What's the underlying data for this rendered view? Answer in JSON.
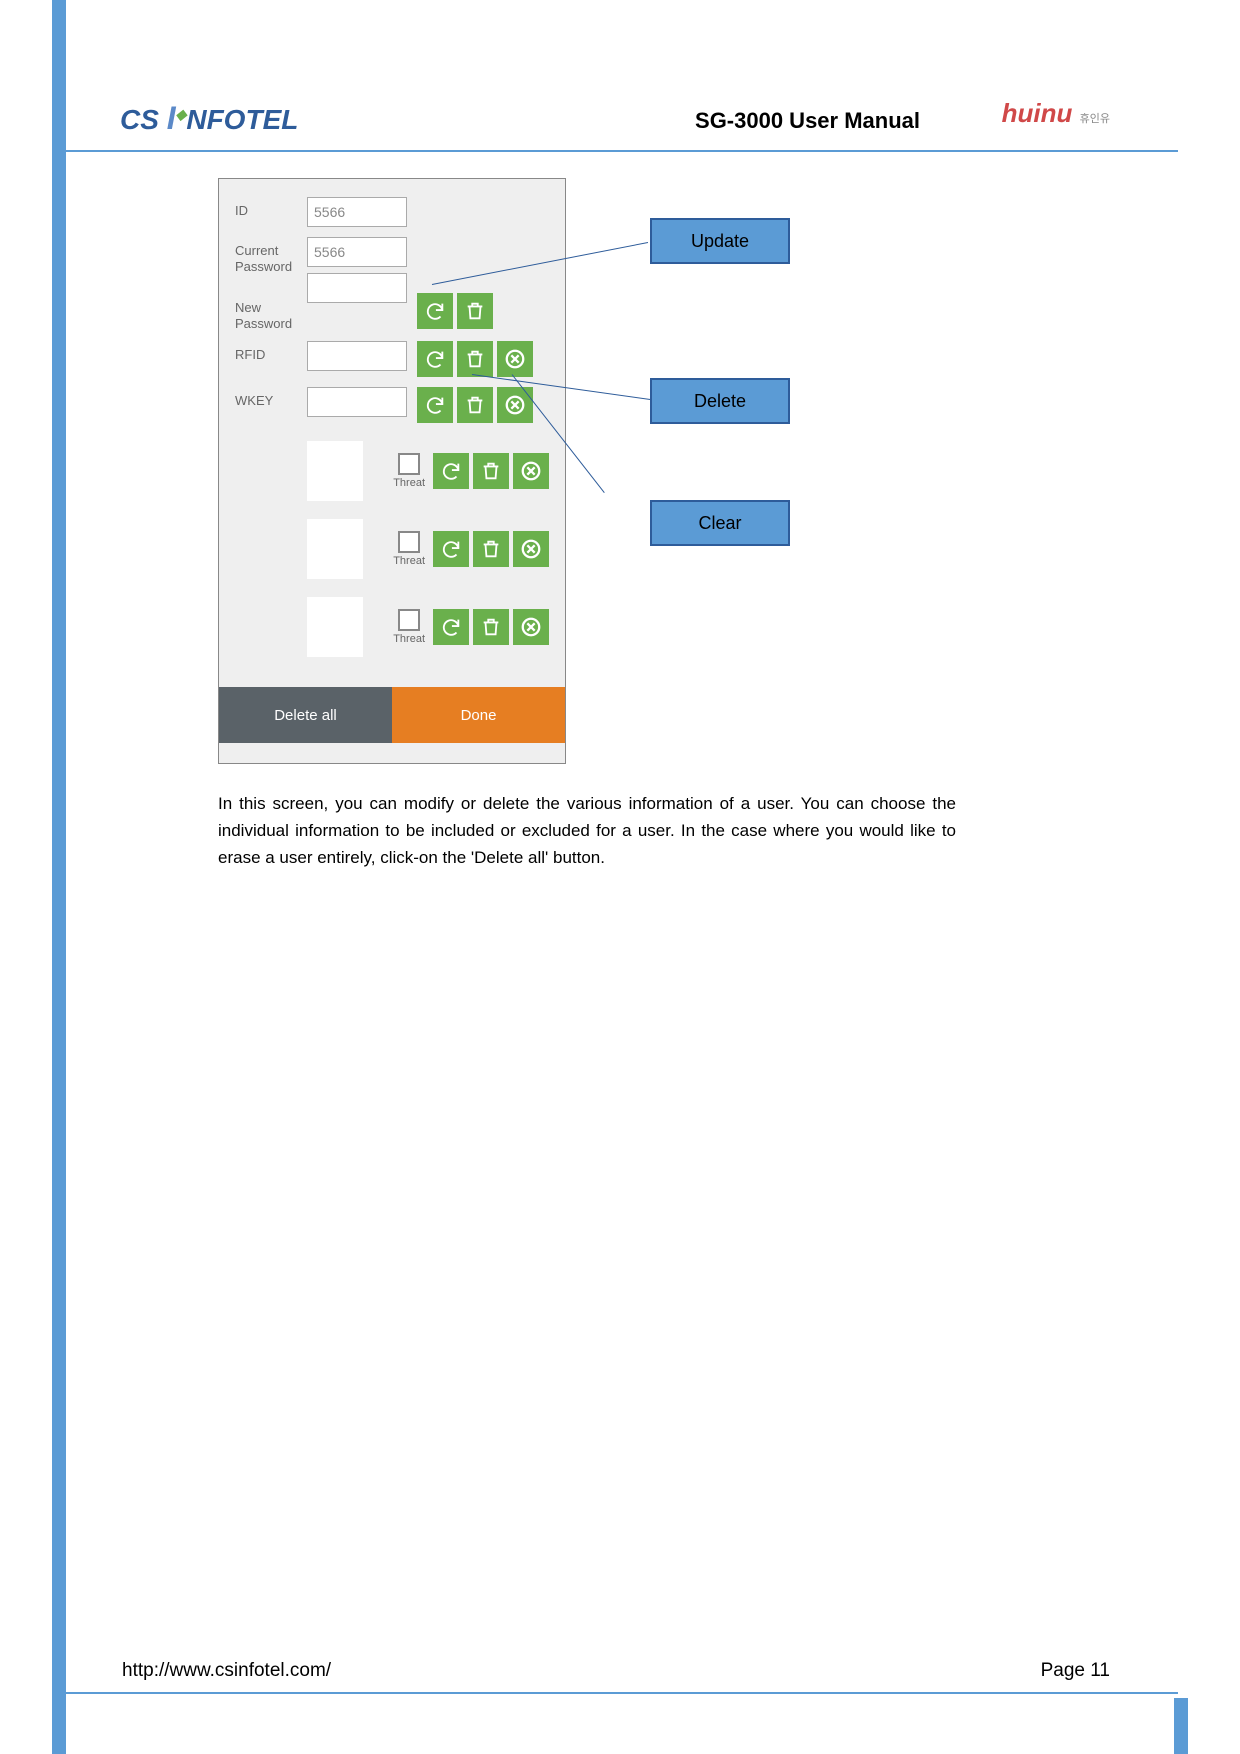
{
  "header": {
    "logo1": "CS INFOTEL",
    "title": "SG-3000 User Manual",
    "logo2": "huinu",
    "logo2sub": "휴인유"
  },
  "app": {
    "labels": {
      "id": "ID",
      "curpw": "Current Password",
      "newpw": "New Password",
      "rfid": "RFID",
      "wkey": "WKEY",
      "threat": "Threat"
    },
    "values": {
      "id": "5566",
      "curpw": "5566"
    },
    "buttons": {
      "delall": "Delete all",
      "done": "Done"
    }
  },
  "callouts": {
    "update": "Update",
    "delete": "Delete",
    "clear": "Clear"
  },
  "bodytext": "In this screen, you can modify or delete the various information of a user. You can choose the individual information to be included or excluded for a user. In the case where you would like to erase a user entirely, click-on the 'Delete all' button.",
  "footer": {
    "url": "http://www.csinfotel.com/",
    "page": "Page 11"
  }
}
